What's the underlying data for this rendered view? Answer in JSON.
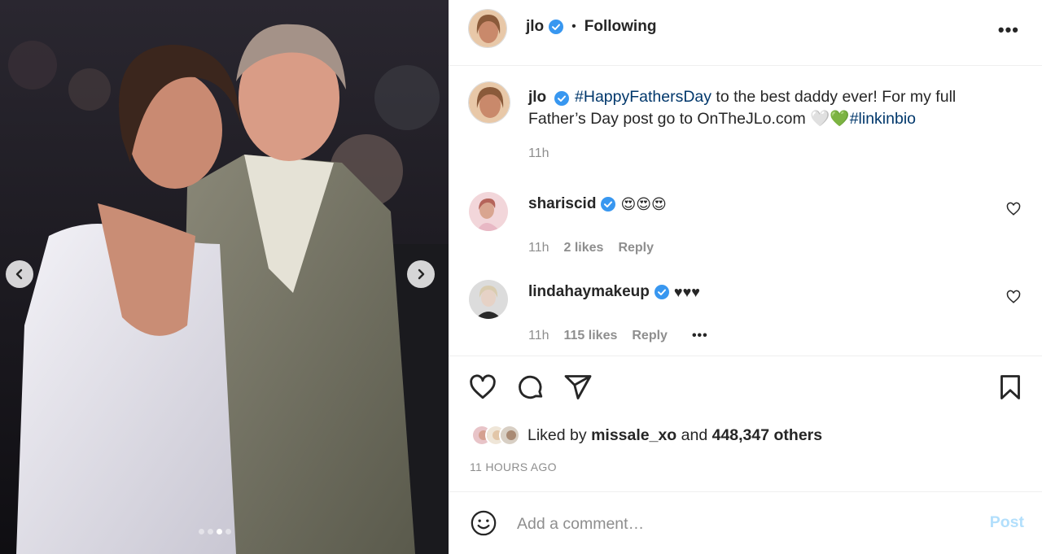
{
  "media": {
    "carousel_dots": 4,
    "active_dot_index": 2,
    "prev_icon": "chevron-left-icon",
    "next_icon": "chevron-right-icon"
  },
  "header": {
    "username": "jlo",
    "separator": "•",
    "follow_status": "Following",
    "more_icon": "more-horizontal-icon",
    "more_glyph": "•••"
  },
  "caption": {
    "username": "jlo",
    "text_parts": {
      "hashtag1": "#HappyFathersDay",
      "text1": " to the best daddy ever! For my full Father’s Day post go to OnTheJLo.com ",
      "emojis": "🤍💚",
      "hashtag2": "#linkinbio"
    },
    "time": "11h"
  },
  "comments": [
    {
      "username": "shariscid",
      "text": "😍😍😍",
      "time": "11h",
      "likes": "2 likes",
      "reply": "Reply"
    },
    {
      "username": "lindahaymakeup",
      "text": "♥♥♥",
      "time": "11h",
      "likes": "115 likes",
      "reply": "Reply",
      "more": "•••"
    }
  ],
  "actions": {
    "like_icon": "heart-icon",
    "comment_icon": "comment-icon",
    "share_icon": "send-icon",
    "save_icon": "bookmark-icon"
  },
  "likes": {
    "prefix": "Liked by ",
    "user": "missale_xo",
    "middle": " and ",
    "count": "448,347 others"
  },
  "post_age": "11 HOURS AGO",
  "add_comment": {
    "placeholder": "Add a comment…",
    "post_label": "Post"
  },
  "colors": {
    "verified": "#3897f0",
    "hashtag": "#00376b",
    "post_disabled": "#b2dffc",
    "muted": "#8e8e8e"
  }
}
